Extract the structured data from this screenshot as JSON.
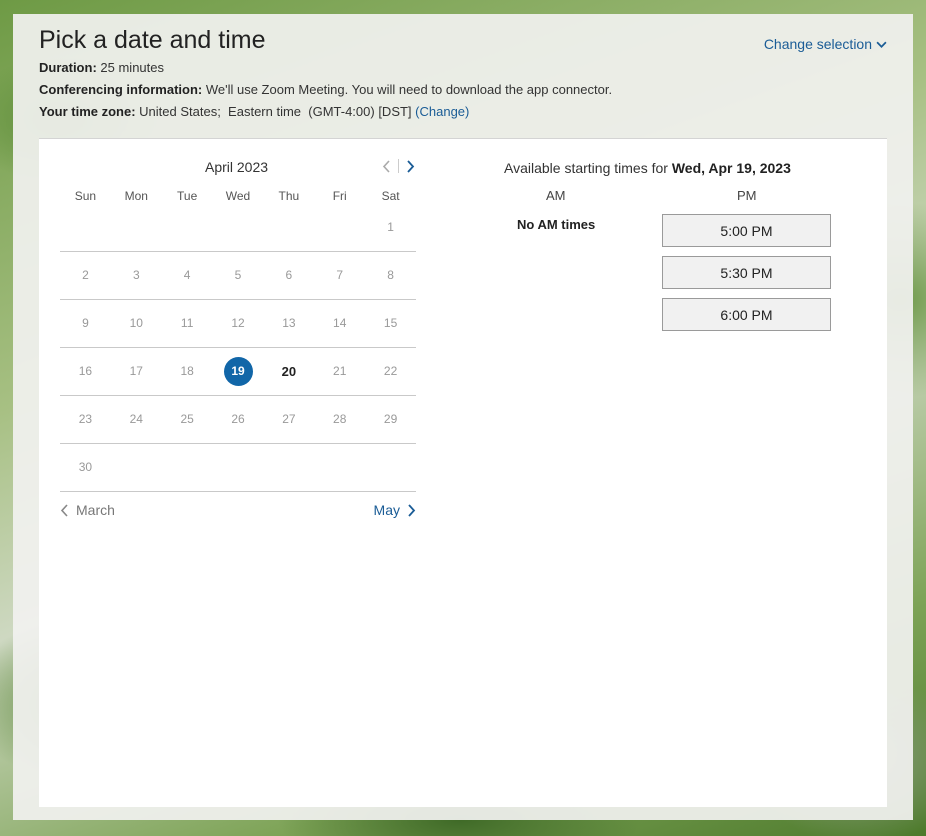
{
  "header": {
    "title": "Pick a date and time",
    "duration_label": "Duration:",
    "duration_value": "25 minutes",
    "conferencing_label": "Conferencing information:",
    "conferencing_value": "We'll use Zoom Meeting. You will need to download the app connector.",
    "timezone_label": "Your time zone:",
    "timezone_value": "United States;  Eastern time  (GMT-4:00) [DST]",
    "timezone_change": "(Change)",
    "change_selection": "Change selection"
  },
  "calendar": {
    "month_label": "April 2023",
    "weekdays": [
      "Sun",
      "Mon",
      "Tue",
      "Wed",
      "Thu",
      "Fri",
      "Sat"
    ],
    "weeks": [
      [
        "",
        "",
        "",
        "",
        "",
        "",
        "1"
      ],
      [
        "2",
        "3",
        "4",
        "5",
        "6",
        "7",
        "8"
      ],
      [
        "9",
        "10",
        "11",
        "12",
        "13",
        "14",
        "15"
      ],
      [
        "16",
        "17",
        "18",
        "19",
        "20",
        "21",
        "22"
      ],
      [
        "23",
        "24",
        "25",
        "26",
        "27",
        "28",
        "29"
      ],
      [
        "30",
        "",
        "",
        "",
        "",
        "",
        ""
      ]
    ],
    "selected_day": "19",
    "available_days": [
      "19",
      "20"
    ],
    "prev_month": "March",
    "next_month": "May"
  },
  "times": {
    "title_prefix": "Available starting times for",
    "title_date": "Wed, Apr 19, 2023",
    "am_label": "AM",
    "pm_label": "PM",
    "no_am": "No AM times",
    "pm_slots": [
      "5:00 PM",
      "5:30 PM",
      "6:00 PM"
    ]
  },
  "colors": {
    "accent": "#1166a8",
    "link": "#1a5c96"
  }
}
